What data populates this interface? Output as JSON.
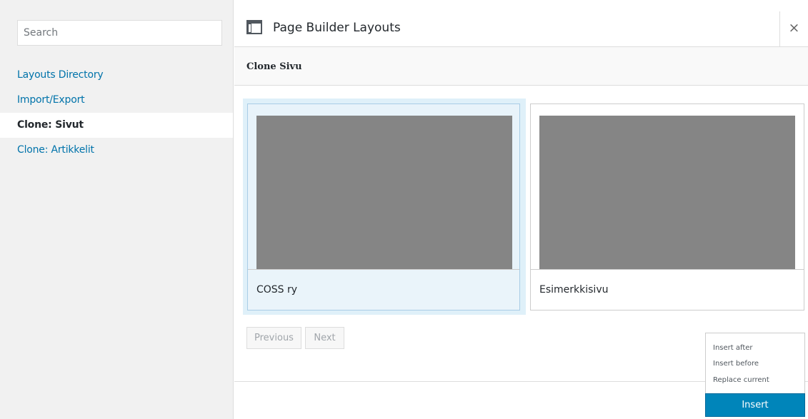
{
  "sidebar": {
    "search_placeholder": "Search",
    "items": [
      {
        "label": "Layouts Directory"
      },
      {
        "label": "Import/Export"
      },
      {
        "label": "Clone: Sivut"
      },
      {
        "label": "Clone: Artikkelit"
      }
    ],
    "active_item": "Clone: Sivut"
  },
  "header": {
    "title": "Page Builder Layouts",
    "icon": "layout-icon",
    "close_label": "×"
  },
  "section": {
    "title": "Clone Sivu"
  },
  "layouts": [
    {
      "name": "COSS ry",
      "selected": true
    },
    {
      "name": "Esimerkkisivu",
      "selected": false
    }
  ],
  "pagination": {
    "previous_label": "Previous",
    "next_label": "Next"
  },
  "insert_options": [
    {
      "label": "Insert after"
    },
    {
      "label": "Insert before"
    },
    {
      "label": "Replace current"
    }
  ],
  "insert_button": "Insert",
  "colors": {
    "accent": "#0085ba",
    "link": "#0073aa",
    "thumb": "#858585",
    "selected_bg": "#dff0f9"
  }
}
